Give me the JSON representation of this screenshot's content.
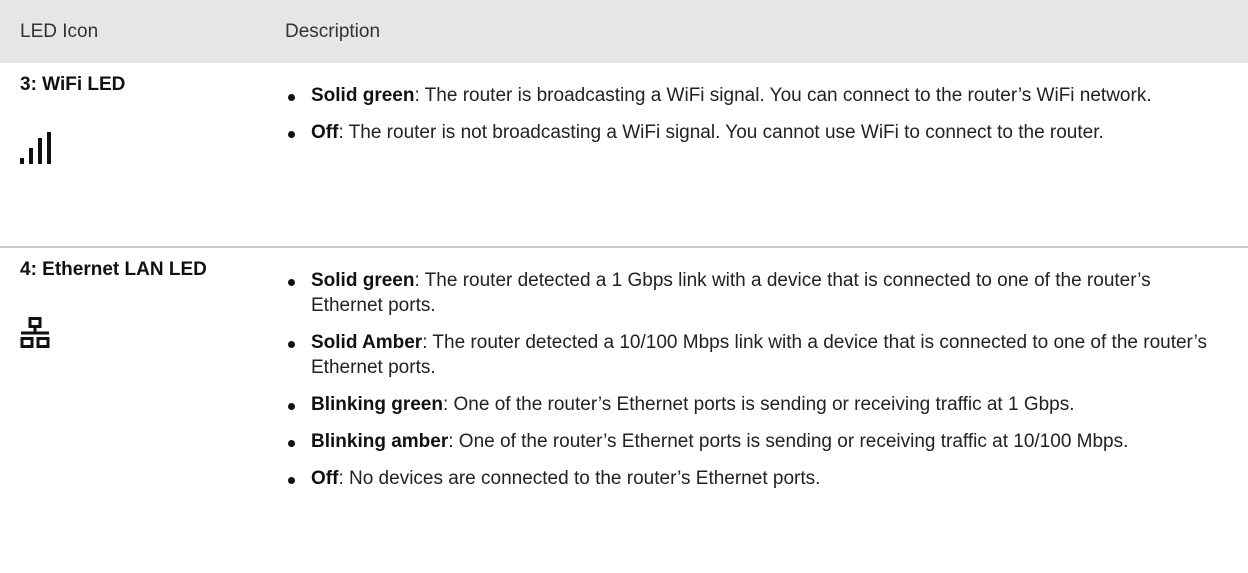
{
  "table": {
    "header": {
      "col1": "LED Icon",
      "col2": "Description"
    },
    "rows": [
      {
        "name": "3: WiFi LED",
        "icon": "wifi-signal-bars-icon",
        "items": [
          {
            "term": "Solid green",
            "text": ": The router is broadcasting a WiFi signal. You can connect to the router’s WiFi network."
          },
          {
            "term": "Off",
            "text": ": The router is not broadcasting a WiFi signal. You cannot use WiFi to connect to the router."
          }
        ]
      },
      {
        "name": "4: Ethernet LAN LED",
        "icon": "ethernet-network-icon",
        "items": [
          {
            "term": "Solid green",
            "text": ": The router detected a 1 Gbps link with a device that is connected to one of the router’s Ethernet ports."
          },
          {
            "term": "Solid Amber",
            "text": ": The router detected a 10/100 Mbps link with a device that is connected to one of the router’s Ethernet ports."
          },
          {
            "term": "Blinking green",
            "text": ": One of the router’s Ethernet ports is sending or receiving traffic at 1 Gbps."
          },
          {
            "term": "Blinking amber",
            "text": ": One of the router’s Ethernet ports is sending or receiving traffic at 10/100 Mbps."
          },
          {
            "term": "Off",
            "text": ": No devices are connected to the router’s Ethernet ports."
          }
        ]
      }
    ]
  }
}
